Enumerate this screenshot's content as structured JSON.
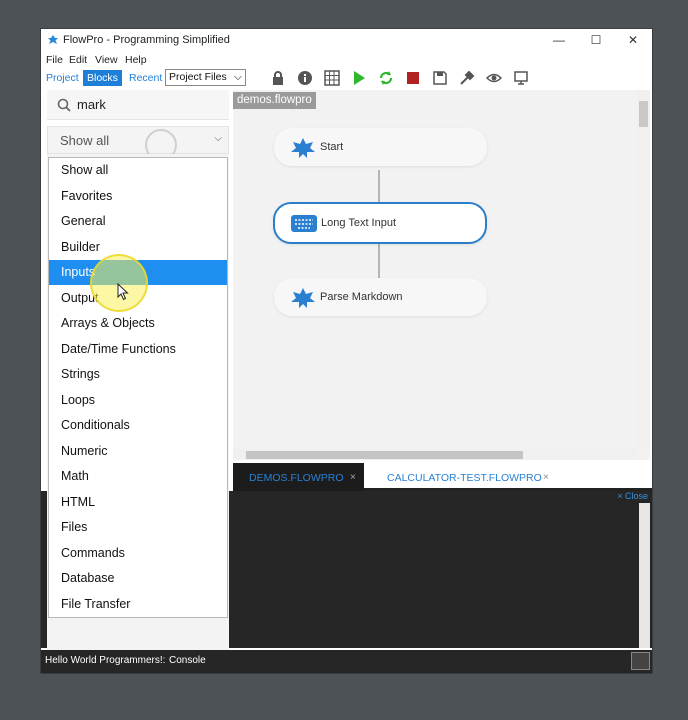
{
  "window": {
    "title": "FlowPro - Programming Simplified"
  },
  "menu": [
    "File",
    "Edit",
    "View",
    "Help"
  ],
  "toolbar": {
    "tabs": [
      {
        "label": "Project",
        "active": false
      },
      {
        "label": "Blocks",
        "active": true
      },
      {
        "label": "Recent",
        "active": false
      }
    ],
    "select_value": "Project Files",
    "icons": [
      "lock-icon",
      "info-icon",
      "grid-icon",
      "run-icon",
      "refresh-icon",
      "stop-icon",
      "save-icon",
      "build-icon",
      "preview-icon",
      "monitor-icon"
    ]
  },
  "sidebar": {
    "search_value": "mark",
    "filter_value": "Show all",
    "dropdown_options": [
      "Show all",
      "Favorites",
      "General",
      "Builder",
      "Inputs",
      "Output",
      "Arrays & Objects",
      "Date/Time Functions",
      "Strings",
      "Loops",
      "Conditionals",
      "Numeric",
      "Math",
      "HTML",
      "Files",
      "Commands",
      "Database",
      "File Transfer"
    ],
    "highlighted_option": "Inputs"
  },
  "editor": {
    "file_label": "demos.flowpro",
    "nodes": [
      {
        "label": "Start",
        "icon": "leaf-icon"
      },
      {
        "label": "Long Text Input",
        "icon": "keyboard-icon"
      },
      {
        "label": "Parse Markdown",
        "icon": "leaf-icon"
      }
    ]
  },
  "tabs": [
    {
      "label": "DEMOS.FLOWPRO",
      "active": true,
      "close": "×"
    },
    {
      "label": "CALCULATOR-TEST.FLOWPRO",
      "active": false,
      "close": "×"
    }
  ],
  "console": {
    "close_label": "× Close"
  },
  "status": {
    "message": "Hello World Programmers!:",
    "console_label": "Console"
  },
  "colors": {
    "accent": "#1e7fd9",
    "selection": "#1e8ff0",
    "node_border": "#2c7fc9",
    "run_green": "#2db82d",
    "stop_red": "#b22222",
    "console_bg": "#262626"
  }
}
